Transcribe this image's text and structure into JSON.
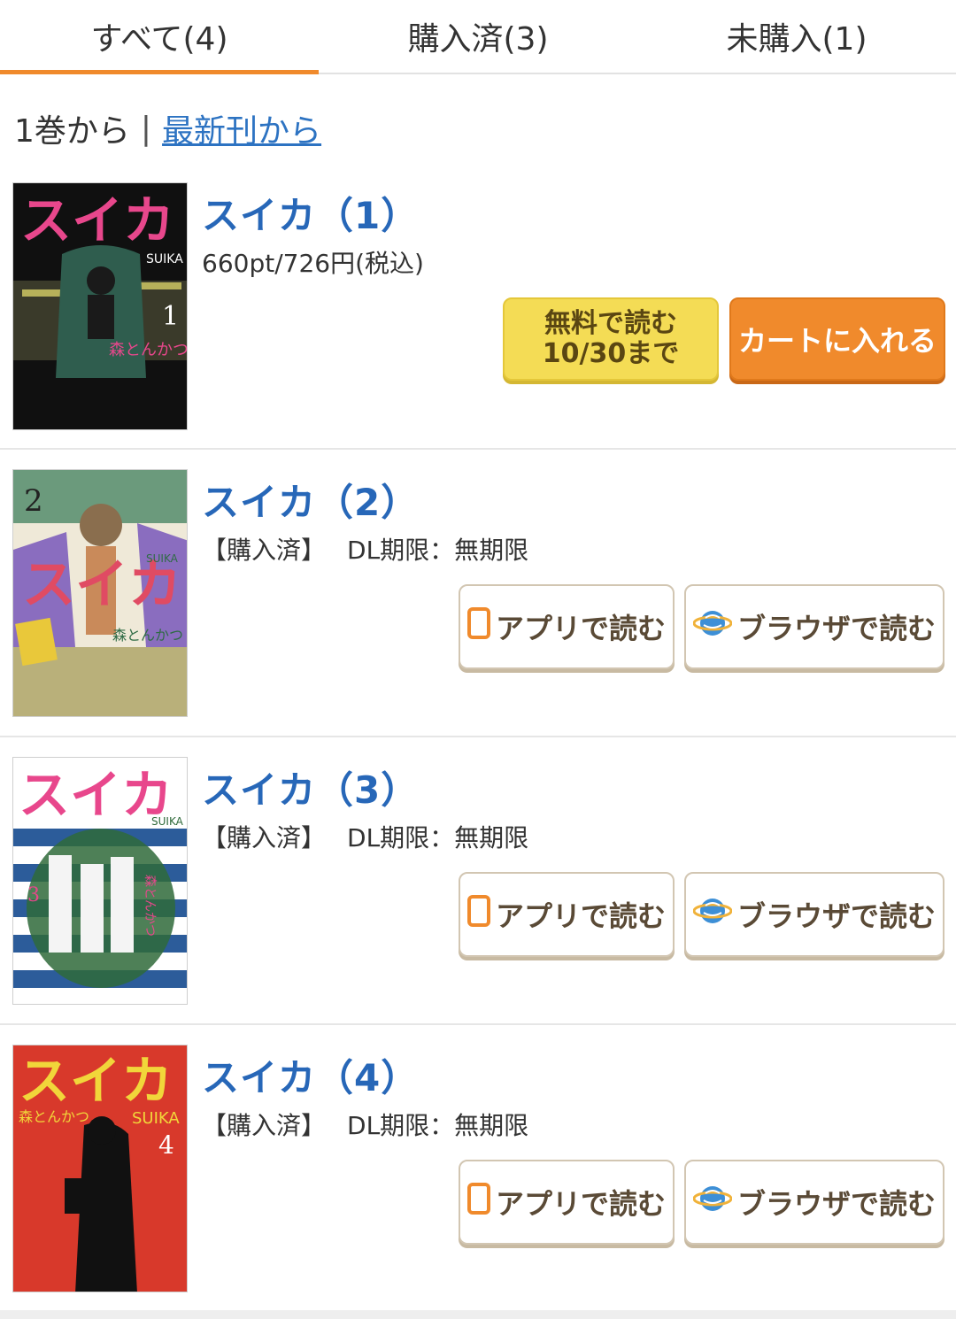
{
  "tabs": [
    {
      "label": "すべて(4)",
      "active": true
    },
    {
      "label": "購入済(3)",
      "active": false
    },
    {
      "label": "未購入(1)",
      "active": false
    }
  ],
  "sort": {
    "from_first": "1巻から",
    "separator": "|",
    "from_latest": "最新刊から"
  },
  "items": [
    {
      "title": "スイカ（1）",
      "price": "660pt/726円(税込)",
      "buttons": {
        "free_read_line1": "無料で読む",
        "free_read_line2": "10/30まで",
        "add_to_cart": "カートに入れる"
      },
      "cover": {
        "bg": "#0f0f0f",
        "accent": "#e8478c",
        "sub": "SUIKA",
        "author": "森とんかつ",
        "volume": "1"
      }
    },
    {
      "title": "スイカ（2）",
      "status": "【購入済】",
      "dl_limit": "DL期限：無期限",
      "buttons": {
        "app_read": "アプリで読む",
        "browser_read": "ブラウザで読む"
      },
      "cover": {
        "bg": "#f5f0e2",
        "accent": "#e04b63",
        "sub": "SUIKA",
        "author": "森とんかつ",
        "volume": "2"
      }
    },
    {
      "title": "スイカ（3）",
      "status": "【購入済】",
      "dl_limit": "DL期限：無期限",
      "buttons": {
        "app_read": "アプリで読む",
        "browser_read": "ブラウザで読む"
      },
      "cover": {
        "bg": "#ffffff",
        "accent": "#e8478c",
        "sub": "SUIKA",
        "author": "森とんかつ",
        "volume": "3"
      }
    },
    {
      "title": "スイカ（4）",
      "status": "【購入済】",
      "dl_limit": "DL期限：無期限",
      "buttons": {
        "app_read": "アプリで読む",
        "browser_read": "ブラウザで読む"
      },
      "cover": {
        "bg": "#d8392b",
        "accent": "#f1d63a",
        "sub": "SUIKA",
        "author": "森とんかつ",
        "volume": "4"
      }
    }
  ],
  "colors": {
    "accent_orange": "#f08a2c",
    "link_blue": "#2d73c2",
    "title_blue": "#2767b8",
    "free_yellow": "#f4dc55"
  },
  "icons": [
    "app-tablet-icon",
    "browser-globe-icon"
  ]
}
